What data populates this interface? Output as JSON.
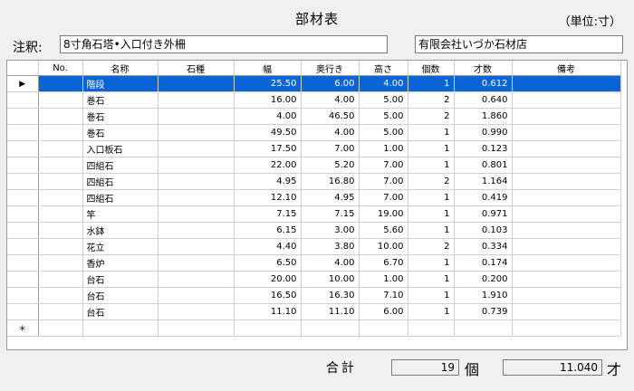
{
  "header": {
    "title": "部材表",
    "unit": "（単位:寸）"
  },
  "note": {
    "label": "注釈:",
    "value": "8寸角石塔•入口付き外柵",
    "company": "有限会社いづか石材店"
  },
  "table": {
    "columns": [
      "No.",
      "名称",
      "石種",
      "幅",
      "奥行き",
      "高さ",
      "個数",
      "才数",
      "備考"
    ],
    "rows": [
      [
        "",
        "階段",
        "",
        "25.50",
        "6.00",
        "4.00",
        "1",
        "0.612",
        ""
      ],
      [
        "",
        "巻石",
        "",
        "16.00",
        "4.00",
        "5.00",
        "2",
        "0.640",
        ""
      ],
      [
        "",
        "巻石",
        "",
        "4.00",
        "46.50",
        "5.00",
        "2",
        "1.860",
        ""
      ],
      [
        "",
        "巻石",
        "",
        "49.50",
        "4.00",
        "5.00",
        "1",
        "0.990",
        ""
      ],
      [
        "",
        "入口板石",
        "",
        "17.50",
        "7.00",
        "1.00",
        "1",
        "0.123",
        ""
      ],
      [
        "",
        "四組石",
        "",
        "22.00",
        "5.20",
        "7.00",
        "1",
        "0.801",
        ""
      ],
      [
        "",
        "四組石",
        "",
        "4.95",
        "16.80",
        "7.00",
        "2",
        "1.164",
        ""
      ],
      [
        "",
        "四組石",
        "",
        "12.10",
        "4.95",
        "7.00",
        "1",
        "0.419",
        ""
      ],
      [
        "",
        "竿",
        "",
        "7.15",
        "7.15",
        "19.00",
        "1",
        "0.971",
        ""
      ],
      [
        "",
        "水鉢",
        "",
        "6.15",
        "3.00",
        "5.60",
        "1",
        "0.103",
        ""
      ],
      [
        "",
        "花立",
        "",
        "4.40",
        "3.80",
        "10.00",
        "2",
        "0.334",
        ""
      ],
      [
        "",
        "香炉",
        "",
        "6.50",
        "4.00",
        "6.70",
        "1",
        "0.174",
        ""
      ],
      [
        "",
        "台石",
        "",
        "20.00",
        "10.00",
        "1.00",
        "1",
        "0.200",
        ""
      ],
      [
        "",
        "台石",
        "",
        "16.50",
        "16.30",
        "7.10",
        "1",
        "1.910",
        ""
      ],
      [
        "",
        "台石",
        "",
        "11.10",
        "11.10",
        "6.00",
        "1",
        "0.739",
        ""
      ]
    ],
    "selected_marker": "▶",
    "new_row_marker": "＊"
  },
  "totals": {
    "label": "合計",
    "count": "19",
    "count_unit": "個",
    "volume": "11.040",
    "volume_unit": "才"
  },
  "colors": {
    "selection": "#0a64d6",
    "background": "#f0f0f0"
  }
}
